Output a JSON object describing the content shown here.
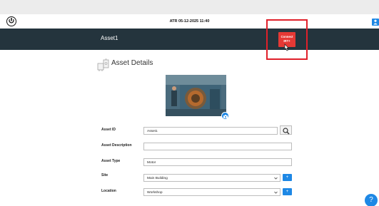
{
  "status_bar": {
    "timestamp": "ATR 05-12-2025 11:40"
  },
  "header": {
    "asset_title": "Asset1",
    "connect_button_label": "Connect IRT+"
  },
  "section": {
    "title": "Asset Details"
  },
  "form": {
    "asset_id": {
      "label": "Asset ID",
      "value": "Asset1"
    },
    "asset_description": {
      "label": "Asset Description",
      "value": ""
    },
    "asset_type": {
      "label": "Asset Type",
      "value": "Motor"
    },
    "site": {
      "label": "Site",
      "value": "Main Building"
    },
    "location": {
      "label": "Location",
      "value": "Workshop"
    }
  },
  "buttons": {
    "help_label": "?",
    "add_label": "+"
  },
  "colors": {
    "header_bg": "#24343d",
    "accent_blue": "#1e88e5",
    "connect_red": "#e53935",
    "highlight": "#e0202a"
  },
  "icons": [
    "power-logo-icon",
    "user-icon",
    "cursor-icon",
    "asset-details-icon",
    "camera-icon",
    "search-icon",
    "chevron-down-icon",
    "plus-icon",
    "help-icon"
  ]
}
